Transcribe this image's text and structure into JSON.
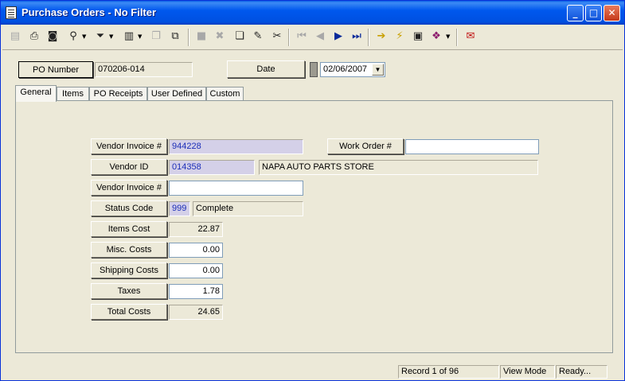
{
  "window": {
    "title": "Purchase Orders - No Filter"
  },
  "header": {
    "po_number_label": "PO Number",
    "po_number_value": "070206-014",
    "date_label": "Date",
    "date_value": "02/06/2007"
  },
  "tabs": [
    {
      "label": "General"
    },
    {
      "label": "Items"
    },
    {
      "label": "PO Receipts"
    },
    {
      "label": "User Defined"
    },
    {
      "label": "Custom"
    }
  ],
  "form": {
    "vendor_invoice_label": "Vendor Invoice #",
    "vendor_invoice_value": "944228",
    "work_order_label": "Work Order #",
    "work_order_value": "",
    "vendor_id_label": "Vendor ID",
    "vendor_id_value": "014358",
    "vendor_name": "NAPA AUTO PARTS STORE",
    "vendor_invoice2_label": "Vendor Invoice #",
    "vendor_invoice2_value": "",
    "status_code_label": "Status Code",
    "status_code_value": "999",
    "status_text": "Complete",
    "items_cost_label": "Items Cost",
    "items_cost_value": "22.87",
    "misc_costs_label": "Misc. Costs",
    "misc_costs_value": "0.00",
    "shipping_costs_label": "Shipping Costs",
    "shipping_costs_value": "0.00",
    "taxes_label": "Taxes",
    "taxes_value": "1.78",
    "total_costs_label": "Total Costs",
    "total_costs_value": "24.65"
  },
  "statusbar": {
    "record": "Record 1 of 96",
    "mode": "View Mode",
    "state": "Ready..."
  },
  "colors": {
    "titlebar": "#0058EE",
    "face": "#ECE9D8",
    "readonly_blue_text": "#1C2EB8"
  }
}
